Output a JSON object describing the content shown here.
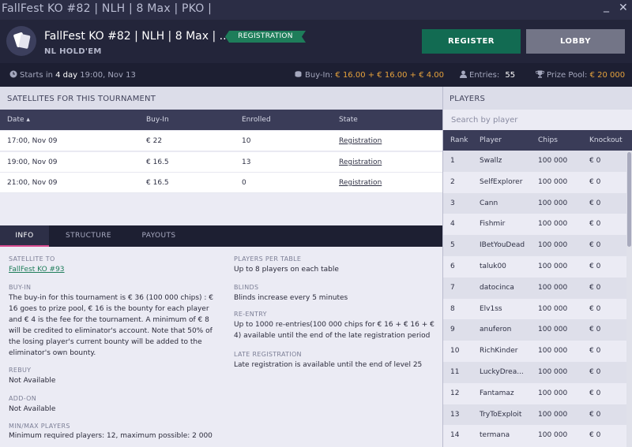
{
  "window": {
    "title": "FallFest KO #82 | NLH | 8 Max | PKO |",
    "minimize_glyph": "_",
    "close_glyph": "✕"
  },
  "header": {
    "icon": "cards-icon",
    "title": "FallFest KO #82 | NLH | 8 Max | ...",
    "subtitle": "NL HOLD'EM",
    "badge": "REGISTRATION",
    "register_label": "REGISTER",
    "lobby_label": "LOBBY"
  },
  "infostrip": {
    "starts_prefix": "Starts in",
    "starts_highlight": "4 day",
    "starts_time": "19:00, Nov 13",
    "buyin_label": "Buy-In:",
    "buyin_value": "€ 16.00 + € 16.00 + € 4.00",
    "entries_label": "Entries:",
    "entries_value": "55",
    "prizepool_label": "Prize Pool:",
    "prizepool_value": "€ 20 000"
  },
  "satellites": {
    "heading": "SATELLITES FOR THIS TOURNAMENT",
    "columns": [
      "Date ▴",
      "Buy-In",
      "Enrolled",
      "State"
    ],
    "rows": [
      {
        "date": "17:00, Nov 09",
        "buyin": "€ 22",
        "enrolled": "10",
        "state": "Registration"
      },
      {
        "date": "19:00, Nov 09",
        "buyin": "€ 16.5",
        "enrolled": "13",
        "state": "Registration"
      },
      {
        "date": "21:00, Nov 09",
        "buyin": "€ 16.5",
        "enrolled": "0",
        "state": "Registration"
      }
    ]
  },
  "tabs": [
    "INFO",
    "STRUCTURE",
    "PAYOUTS"
  ],
  "info": {
    "satellite_to_label": "SATELLITE TO",
    "satellite_to_value": "FallFest KO #93",
    "buyin_label": "BUY-IN",
    "buyin_text": "The buy-in for this tournament is € 36 (100 000 chips) : € 16 goes to prize pool, € 16 is the bounty for each player and € 4 is the fee for the tournament. A minimum of € 8 will be credited to eliminator's account. Note that 50% of the losing player's current bounty will be added to the eliminator's own bounty.",
    "rebuy_label": "REBUY",
    "rebuy_value": "Not Available",
    "addon_label": "ADD-ON",
    "addon_value": "Not Available",
    "minmax_label": "MIN/MAX PLAYERS",
    "minmax_value": "Minimum required players: 12, maximum possible: 2 000",
    "ppt_label": "PLAYERS PER TABLE",
    "ppt_value": "Up to 8 players on each table",
    "blinds_label": "BLINDS",
    "blinds_value": "Blinds increase every 5 minutes",
    "reentry_label": "RE-ENTRY",
    "reentry_value": "Up to 1000 re-entries(100 000 chips for € 16 + € 16 + € 4) available until the end of the late registration period",
    "latereg_label": "LATE REGISTRATION",
    "latereg_value": "Late registration is available until the end of level 25"
  },
  "players": {
    "heading": "PLAYERS",
    "search_placeholder": "Search by player",
    "columns": [
      "Rank",
      "Player",
      "Chips",
      "Knockout"
    ],
    "rows": [
      {
        "rank": "1",
        "player": "Swallz",
        "chips": "100 000",
        "ko": "€ 0"
      },
      {
        "rank": "2",
        "player": "SelfExplorer",
        "chips": "100 000",
        "ko": "€ 0"
      },
      {
        "rank": "3",
        "player": "Cann",
        "chips": "100 000",
        "ko": "€ 0"
      },
      {
        "rank": "4",
        "player": "Fishmir",
        "chips": "100 000",
        "ko": "€ 0"
      },
      {
        "rank": "5",
        "player": "IBetYouDead",
        "chips": "100 000",
        "ko": "€ 0"
      },
      {
        "rank": "6",
        "player": "taluk00",
        "chips": "100 000",
        "ko": "€ 0"
      },
      {
        "rank": "7",
        "player": "datocinca",
        "chips": "100 000",
        "ko": "€ 0"
      },
      {
        "rank": "8",
        "player": "Elv1ss",
        "chips": "100 000",
        "ko": "€ 0"
      },
      {
        "rank": "9",
        "player": "anuferon",
        "chips": "100 000",
        "ko": "€ 0"
      },
      {
        "rank": "10",
        "player": "RichKinder",
        "chips": "100 000",
        "ko": "€ 0"
      },
      {
        "rank": "11",
        "player": "LuckyDrea...",
        "chips": "100 000",
        "ko": "€ 0"
      },
      {
        "rank": "12",
        "player": "Fantamaz",
        "chips": "100 000",
        "ko": "€ 0"
      },
      {
        "rank": "13",
        "player": "TryToExploit",
        "chips": "100 000",
        "ko": "€ 0"
      },
      {
        "rank": "14",
        "player": "termana",
        "chips": "100 000",
        "ko": "€ 0"
      }
    ]
  }
}
